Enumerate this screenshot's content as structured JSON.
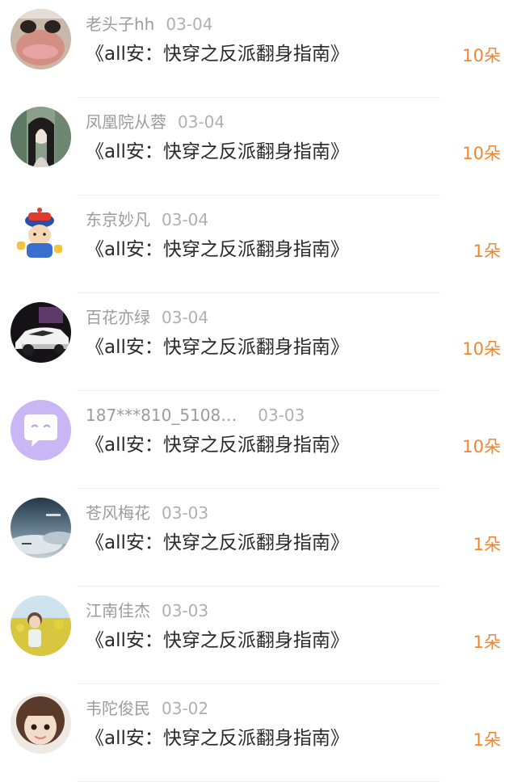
{
  "gifts": [
    {
      "user": "老头子hh",
      "date": "03-04",
      "book": "《all安：快穿之反派翻身指南》",
      "amount": "10朵",
      "avatar": "photo-avatar"
    },
    {
      "user": "凤凰院从蓉",
      "date": "03-04",
      "book": "《all安：快穿之反派翻身指南》",
      "amount": "10朵",
      "avatar": "photo-avatar"
    },
    {
      "user": "东京妙凡",
      "date": "03-04",
      "book": "《all安：快穿之反派翻身指南》",
      "amount": "1朵",
      "avatar": "cartoon-avatar"
    },
    {
      "user": "百花亦绿",
      "date": "03-04",
      "book": "《all安：快穿之反派翻身指南》",
      "amount": "10朵",
      "avatar": "car-photo-avatar"
    },
    {
      "user": "187***810_5108…",
      "date": "03-03",
      "book": "《all安：快穿之反派翻身指南》",
      "amount": "10朵",
      "avatar": "default-chat-avatar"
    },
    {
      "user": "苍风梅花",
      "date": "03-03",
      "book": "《all安：快穿之反派翻身指南》",
      "amount": "1朵",
      "avatar": "sky-photo-avatar"
    },
    {
      "user": "江南佳杰",
      "date": "03-03",
      "book": "《all安：快穿之反派翻身指南》",
      "amount": "1朵",
      "avatar": "photo-avatar"
    },
    {
      "user": "韦陀俊民",
      "date": "03-02",
      "book": "《all安：快穿之反派翻身指南》",
      "amount": "1朵",
      "avatar": "photo-avatar"
    }
  ],
  "colors": {
    "amount": "#f0862e",
    "meta": "#9c9c9c",
    "title": "#2a2a2a",
    "default_avatar_bg": "#c8b6f5"
  }
}
